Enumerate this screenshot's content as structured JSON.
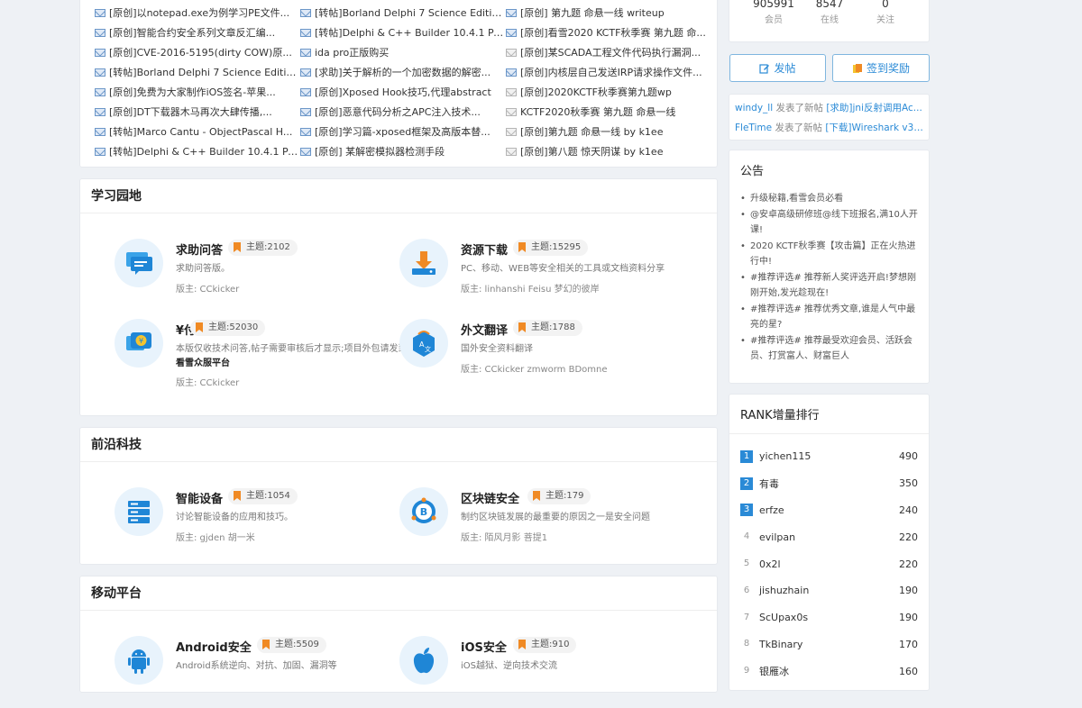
{
  "top_posts": {
    "columns": [
      [
        {
          "title": "[原创]以notepad.exe为例学习PE文件...",
          "read": false
        },
        {
          "title": "[原创]智能合约安全系列文章反汇编...",
          "read": false
        },
        {
          "title": "[原创]CVE-2016-5195(dirty COW)原...",
          "read": false
        },
        {
          "title": "[转帖]Borland Delphi 7 Science Editio...",
          "read": false
        },
        {
          "title": "[原创]免费为大家制作iOS签名-苹果...",
          "read": false
        },
        {
          "title": "[原创]DT下载器木马再次大肆传播,...",
          "read": false
        },
        {
          "title": "[转帖]Marco Cantu - ObjectPascal H...",
          "read": false
        },
        {
          "title": "[转帖]Delphi & C++ Builder 10.4.1 Pa...",
          "read": false
        }
      ],
      [
        {
          "title": "[转帖]Borland Delphi 7 Science Editio...",
          "read": false
        },
        {
          "title": "[转帖]Delphi & C++ Builder 10.4.1 Pa...",
          "read": false
        },
        {
          "title": "ida pro正版购买",
          "read": false
        },
        {
          "title": "[求助]关于解析的一个加密数据的解密...",
          "read": false
        },
        {
          "title": "[原创]Xposed Hook技巧,代理abstract",
          "read": false
        },
        {
          "title": "[原创]恶意代码分析之APC注入技术...",
          "read": false
        },
        {
          "title": "[原创]学习篇-xposed框架及高版本替...",
          "read": false
        },
        {
          "title": "[原创] 某解密模拟器检测手段",
          "read": false
        }
      ],
      [
        {
          "title": "[原创] 第九题 命悬一线 writeup",
          "read": false
        },
        {
          "title": "[原创]看雪2020 KCTF秋季赛 第九题 命...",
          "read": false
        },
        {
          "title": "[原创]某SCADA工程文件代码执行漏洞...",
          "read": true
        },
        {
          "title": "[原创]内核层自己发送IRP请求操作文件...",
          "read": false
        },
        {
          "title": "[原创]2020KCTF秋季赛第九题wp",
          "read": true
        },
        {
          "title": "KCTF2020秋季赛 第九题 命悬一线",
          "read": true
        },
        {
          "title": "[原创]第九题 命悬一线 by k1ee",
          "read": true
        },
        {
          "title": "[原创]第八题 惊天阴谋 by k1ee",
          "read": true
        }
      ]
    ]
  },
  "sections": [
    {
      "title": "学习园地",
      "forums": [
        {
          "name": "求助问答",
          "topics": "主题:2102",
          "desc": "求助问答版。",
          "mods": "版主: CCkicker",
          "icon": "chat-bubble-icon"
        },
        {
          "name": "资源下载",
          "topics": "主题:15295",
          "desc": "PC、移动、WEB等安全相关的工具或文档资料分享",
          "mods": "版主: linhanshi   Feisu   梦幻的彼岸",
          "icon": "download-icon"
        },
        {
          "name": "¥付费问答",
          "topics": "主题:52030",
          "desc": "本版仅收技术问答,帖子需要审核后才显示;项目外包请发到",
          "desc_bold": "看雪众服平台",
          "mods": "版主: CCkicker",
          "icon": "yen-chat-icon"
        },
        {
          "name": "外文翻译",
          "topics": "主题:1788",
          "desc": "国外安全资料翻译",
          "mods": "版主: CCkicker   zmworm   BDomne",
          "icon": "translate-icon"
        }
      ]
    },
    {
      "title": "前沿科技",
      "forums": [
        {
          "name": "智能设备",
          "topics": "主题:1054",
          "desc": "讨论智能设备的应用和技巧。",
          "mods": "版主: gjden   胡一米",
          "icon": "server-icon"
        },
        {
          "name": "区块链安全",
          "topics": "主题:179",
          "desc": "制约区块链发展的最重要的原因之一是安全问题",
          "mods": "版主: 陌风月影   菩提1",
          "icon": "bitcoin-icon"
        }
      ]
    },
    {
      "title": "移动平台",
      "forums": [
        {
          "name": "Android安全",
          "topics": "主题:5509",
          "desc": "Android系统逆向、对抗、加固、漏洞等",
          "mods": "",
          "icon": "android-icon"
        },
        {
          "name": "iOS安全",
          "topics": "主题:910",
          "desc": "iOS越狱、逆向技术交流",
          "mods": "",
          "icon": "apple-icon"
        }
      ]
    }
  ],
  "stats": [
    {
      "value": "905991",
      "label": "会员"
    },
    {
      "value": "8547",
      "label": "在线"
    },
    {
      "value": "0",
      "label": "关注"
    }
  ],
  "buttons": {
    "post": "发帖",
    "signin": "签到奖励"
  },
  "feed": [
    {
      "user": "windy_ll",
      "action": " 发表了新帖 ",
      "topic": "[求助]jni反射调用Ac..."
    },
    {
      "user": "FleTime",
      "action": " 发表了新帖 ",
      "topic": "[下载]Wireshark v3...."
    }
  ],
  "notice": {
    "title": "公告",
    "items": [
      "升级秘籍,看雪会员必看",
      "@安卓高级研修班@线下班报名,满10人开课!",
      "2020 KCTF秋季赛【攻击篇】正在火热进行中!",
      "#推荐评选# 推荐新人奖评选开启!梦想刚刚开始,发光趁现在!",
      "#推荐评选# 推荐优秀文章,谁是人气中最亮的星?",
      "#推荐评选# 推荐最受欢迎会员、活跃会员、打赏富人、财富巨人"
    ]
  },
  "rank": {
    "title": "RANK增量排行",
    "rows": [
      {
        "n": "1",
        "name": "yichen115",
        "score": "490"
      },
      {
        "n": "2",
        "name": "有毒",
        "score": "350"
      },
      {
        "n": "3",
        "name": "erfze",
        "score": "240"
      },
      {
        "n": "4",
        "name": "evilpan",
        "score": "220"
      },
      {
        "n": "5",
        "name": "0x2l",
        "score": "220"
      },
      {
        "n": "6",
        "name": "jishuzhain",
        "score": "190"
      },
      {
        "n": "7",
        "name": "ScUpax0s",
        "score": "190"
      },
      {
        "n": "8",
        "name": "TkBinary",
        "score": "170"
      },
      {
        "n": "9",
        "name": "银雁冰",
        "score": "160"
      }
    ]
  },
  "colors": {
    "accent": "#2a8ad6",
    "badge": "#f08a24",
    "icon_bg": "#e8f3fc"
  }
}
